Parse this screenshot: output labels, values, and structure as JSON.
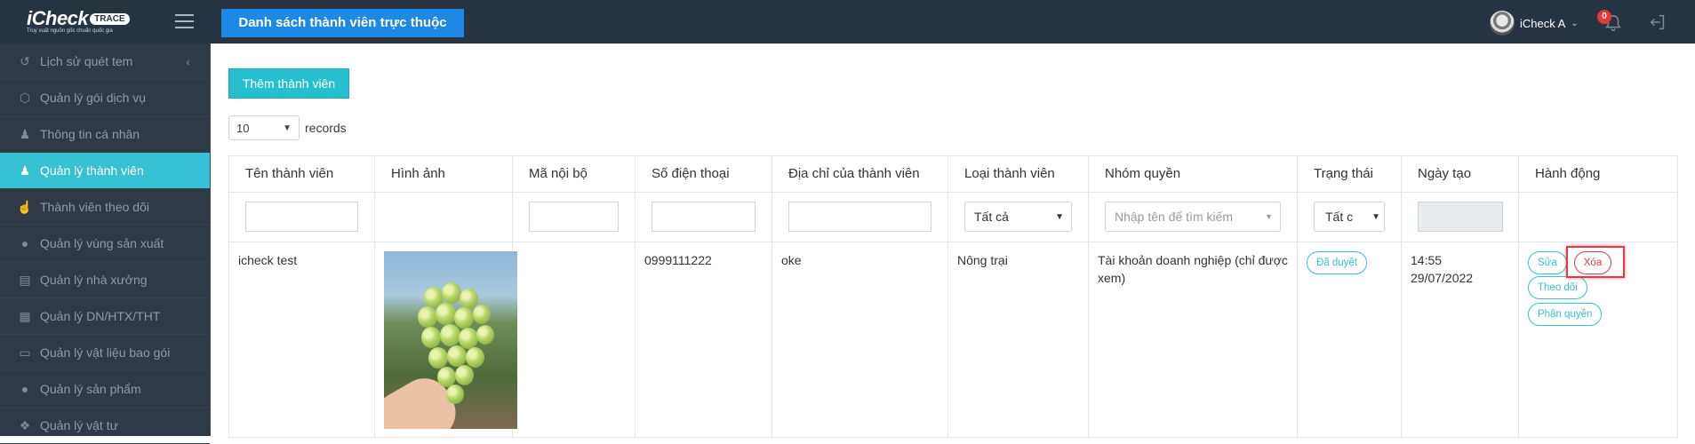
{
  "header": {
    "brand": "iCheck",
    "brand_badge": "TRACE",
    "tagline": "Truy xuất nguồn gốc chuẩn quốc gia",
    "page_title": "Danh sách thành viên trực thuộc",
    "user_name": "iCheck A",
    "notification_count": "0"
  },
  "sidebar": {
    "items": [
      {
        "label": "Lịch sử quét tem",
        "icon": "history-icon"
      },
      {
        "label": "Quản lý gói dịch vụ",
        "icon": "box-icon"
      },
      {
        "label": "Thông tin cá nhân",
        "icon": "user-edit-icon"
      },
      {
        "label": "Quản lý thành viên",
        "icon": "users-icon"
      },
      {
        "label": "Thành viên theo dõi",
        "icon": "thumbs-up-icon"
      },
      {
        "label": "Quản lý vùng sản xuất",
        "icon": "globe-icon"
      },
      {
        "label": "Quản lý nhà xưởng",
        "icon": "factory-icon"
      },
      {
        "label": "Quản lý DN/HTX/THT",
        "icon": "building-icon"
      },
      {
        "label": "Quản lý vật liệu bao gói",
        "icon": "book-icon"
      },
      {
        "label": "Quản lý sản phẩm",
        "icon": "apple-icon"
      },
      {
        "label": "Quản lý vật tư",
        "icon": "tag-icon"
      }
    ]
  },
  "toolbar": {
    "add_label": "Thêm thành viên",
    "page_size": "10",
    "records_label": "records"
  },
  "table": {
    "columns": [
      "Tên thành viên",
      "Hình ảnh",
      "Mã nội bộ",
      "Số điện thoại",
      "Địa chỉ của thành viên",
      "Loại thành viên",
      "Nhóm quyền",
      "Trạng thái",
      "Ngày tạo",
      "Hành động"
    ],
    "filters": {
      "member_type": "Tất cả",
      "group_placeholder": "Nhập tên để tìm kiếm",
      "status": "Tất c"
    },
    "rows": [
      {
        "name": "icheck test",
        "code": "",
        "phone": "0999111222",
        "address": "oke",
        "type": "Nông trại",
        "group": "Tài khoản doanh nghiệp (chỉ được xem)",
        "status": "Đã duyệt",
        "time": "14:55",
        "date": "29/07/2022",
        "actions": {
          "edit": "Sửa",
          "delete": "Xóa",
          "follow": "Theo dõi",
          "permission": "Phân quyền"
        }
      }
    ]
  },
  "colors": {
    "topbar": "#263340",
    "sidebar": "#2f3a46",
    "accent": "#36c1d4",
    "primary": "#1e88e5",
    "danger": "#e53945"
  }
}
